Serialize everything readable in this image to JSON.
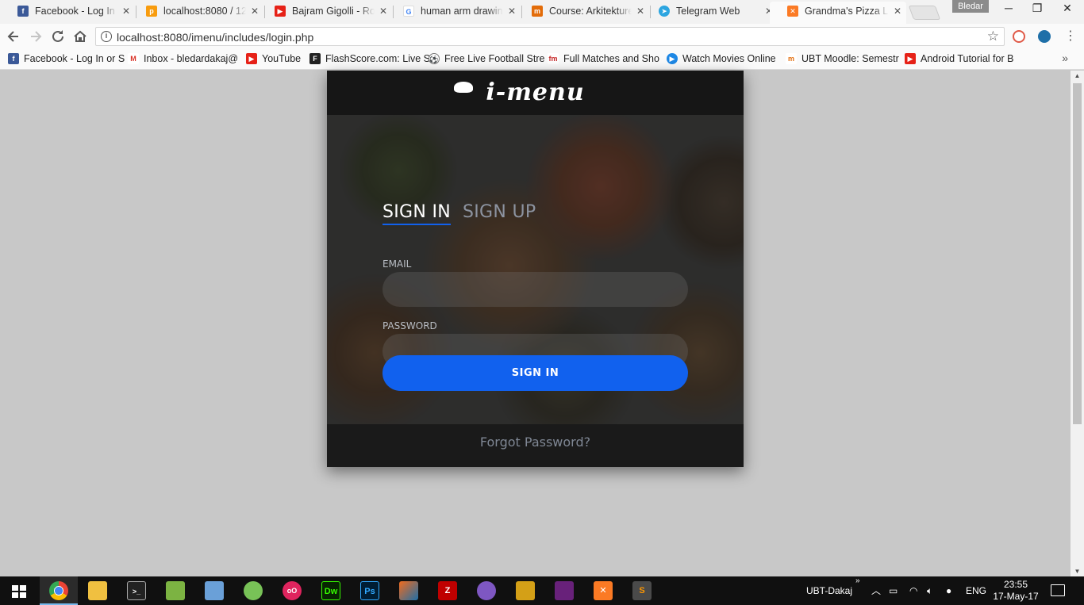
{
  "browser": {
    "tabs": [
      {
        "label": "Facebook - Log In o",
        "favicon": "facebook-icon",
        "color": "#3b5998"
      },
      {
        "label": "localhost:8080 / 12",
        "favicon": "phpmyadmin-icon",
        "color": "#f89c0e"
      },
      {
        "label": "Bajram Gigolli - Ro",
        "favicon": "youtube-icon",
        "color": "#e62117"
      },
      {
        "label": "human arm drawin",
        "favicon": "google-icon",
        "color": "#4285f4"
      },
      {
        "label": "Course: Arkitekture",
        "favicon": "moodle-icon",
        "color": "#e36c09"
      },
      {
        "label": "Telegram Web",
        "favicon": "telegram-icon",
        "color": "#2ca5e0"
      },
      {
        "label": "Grandma's Pizza Lo",
        "favicon": "xampp-icon",
        "color": "#fb7a24"
      }
    ],
    "profile_name": "Bledar",
    "window_controls": {
      "minimize": "─",
      "restore": "❐",
      "close": "✕"
    },
    "url": "localhost:8080/imenu/includes/login.php",
    "bookmarks": [
      {
        "label": "Facebook - Log In or S",
        "icon": "facebook-icon",
        "color": "#3b5998"
      },
      {
        "label": "Inbox - bledardakaj@",
        "icon": "gmail-icon",
        "color": "#d93025"
      },
      {
        "label": "YouTube",
        "icon": "youtube-icon",
        "color": "#e62117"
      },
      {
        "label": "FlashScore.com: Live S",
        "icon": "flashscore-icon",
        "color": "#222222"
      },
      {
        "label": "Free Live Football Stre",
        "icon": "football-icon",
        "color": "#444444"
      },
      {
        "label": "Full Matches and Sho",
        "icon": "fm-icon",
        "color": "#c62828"
      },
      {
        "label": "Watch Movies Online",
        "icon": "play-icon",
        "color": "#1e88e5"
      },
      {
        "label": "UBT Moodle: Semestr",
        "icon": "moodle-icon",
        "color": "#e36c09"
      },
      {
        "label": "Android Tutorial for B",
        "icon": "youtube-icon",
        "color": "#e62117"
      }
    ],
    "bookmarks_more": "»"
  },
  "login": {
    "logo_text": "i-menu",
    "tab_signin": "SIGN IN",
    "tab_signup": "SIGN UP",
    "email_label": "EMAIL",
    "email_value": "",
    "password_label": "PASSWORD",
    "password_value": "",
    "submit_label": "SIGN IN",
    "forgot_label": "Forgot Password?",
    "accent_color": "#1161ee"
  },
  "taskbar": {
    "apps": [
      "chrome-icon",
      "file-explorer-icon",
      "cmd-icon",
      "notepad-icon",
      "virtualbox-icon",
      "android-studio-icon",
      "origin-icon",
      "dreamweaver-icon",
      "photoshop-icon",
      "matlab-icon",
      "filezilla-icon",
      "telegram-icon",
      "tools-icon",
      "visual-studio-icon",
      "xampp-icon",
      "sublime-icon"
    ],
    "app_glyphs": {
      "dreamweaver-icon": "Dw",
      "photoshop-icon": "Ps",
      "sublime-icon": "S"
    },
    "user": "UBT-Dakaj",
    "language": "ENG",
    "time": "23:55",
    "date": "17-May-17"
  }
}
